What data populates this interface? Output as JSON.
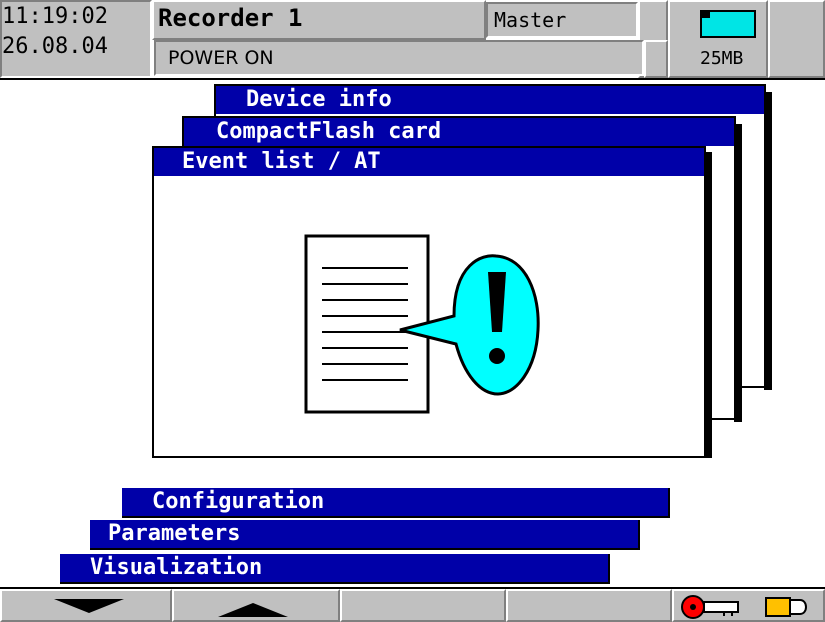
{
  "status": {
    "time": "11:19:02",
    "date": "26.08.04",
    "recorder_name": "Recorder 1",
    "role": "Master",
    "state": "POWER ON",
    "memory": "25MB"
  },
  "windows": [
    {
      "title": "Device info"
    },
    {
      "title": "CompactFlash card"
    },
    {
      "title": "Event list / AT"
    }
  ],
  "menu": {
    "configuration": "Configuration",
    "parameters": "Parameters",
    "visualization": "Visualization"
  },
  "softkeys": {
    "down_icon": "arrow-down-icon",
    "up_icon": "arrow-up-icon",
    "status_icons": [
      "lock-key-icon",
      "cf-card-icon"
    ]
  },
  "colors": {
    "title_blue": "#0000a8",
    "panel_gray": "#c0c0c0",
    "callout_cyan": "#00ffff",
    "lock_red": "#ff0000",
    "card_yellow": "#ffc000"
  }
}
